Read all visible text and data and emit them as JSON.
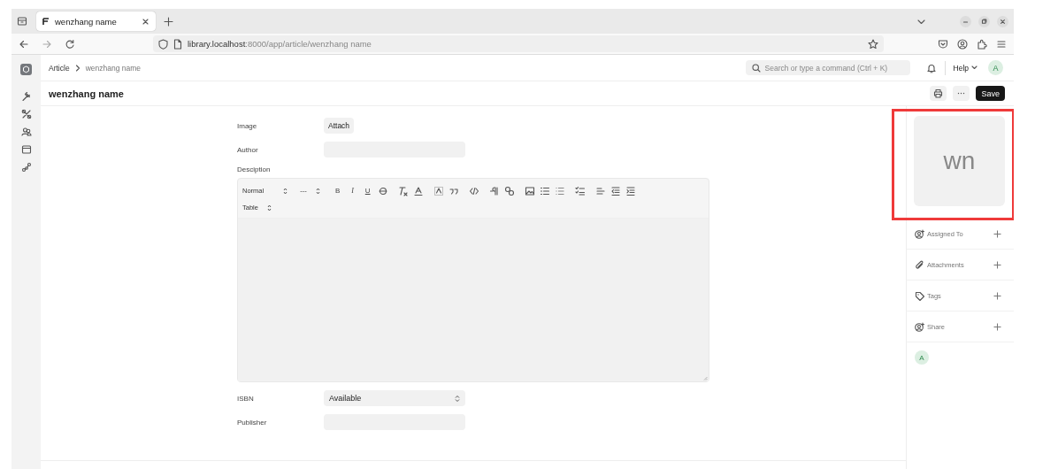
{
  "browser": {
    "tabs": [
      {
        "title": "wenzhang name",
        "selected": true
      }
    ],
    "url": {
      "host": "library.localhost",
      "path": ":8000/app/article/wenzhang name"
    }
  },
  "breadcrumbs": [
    "Article",
    "wenzhang name"
  ],
  "search": {
    "placeholder": "Search or type a command (Ctrl + K)"
  },
  "help": "Help",
  "user_avatar": "A",
  "page_title": "wenzhang name",
  "save_button": "Save",
  "form": [
    {
      "kind": "attach",
      "label": "Image",
      "button": "Attach"
    },
    {
      "kind": "text",
      "label": "Author"
    },
    {
      "kind": "editor",
      "label": "Desciption",
      "toolbar": {
        "selects": [
          "Normal",
          "---"
        ],
        "marks": [
          "B",
          "I",
          "U"
        ],
        "table_select": "Table"
      }
    },
    {
      "kind": "select",
      "label": "ISBN",
      "value": "Available"
    },
    {
      "kind": "text",
      "label": "Publisher"
    }
  ],
  "image_placeholder": "wn",
  "sidebar_sections": [
    {
      "label": "Assigned To"
    },
    {
      "label": "Attachments"
    },
    {
      "label": "Tags"
    },
    {
      "label": "Share"
    }
  ],
  "shared_avatars": [
    "A"
  ]
}
